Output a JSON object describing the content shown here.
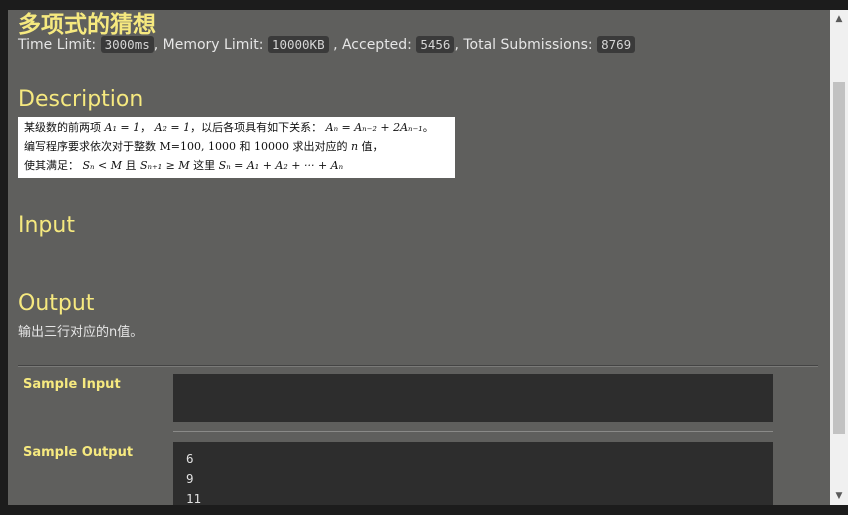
{
  "problem": {
    "title": "多项式的猜想",
    "limits": {
      "time_label": "Time Limit:",
      "time_value": "3000ms",
      "sep1": ",",
      "memory_label": "Memory Limit:",
      "memory_value": "10000KB",
      "sep2": ",",
      "accepted_label": "Accepted:",
      "accepted_value": "5456",
      "sep3": ",",
      "submissions_label": "Total Submissions:",
      "submissions_value": "8769"
    },
    "description_heading": "Description",
    "description_lines": {
      "line1_a": "某级数的前两项",
      "line1_f1": "A₁ = 1",
      "line1_b": "，",
      "line1_f2": "A₂ = 1",
      "line1_c": "，以后各项具有如下关系：",
      "line1_f3": "Aₙ = Aₙ₋₂ + 2Aₙ₋₁",
      "line1_d": "。",
      "line2_a": "编写程序要求依次对于整数 M=100, 1000 和 10000 求出对应的",
      "line2_f": "n",
      "line2_b": "值，",
      "line3_a": "使其满足：",
      "line3_f1": "Sₙ < M",
      "line3_b": "且",
      "line3_f2": "Sₙ₊₁ ≥ M",
      "line3_c": "这里",
      "line3_f3": "Sₙ = A₁ + A₂ + ··· + Aₙ"
    },
    "input_heading": "Input",
    "output_heading": "Output",
    "output_text": "输出三行对应的n值。",
    "sample_input_label": "Sample Input",
    "sample_input": "",
    "sample_output_label": "Sample Output",
    "sample_output_lines": [
      "6",
      "9",
      "11"
    ]
  },
  "colors": {
    "heading": "#f6e97f",
    "background": "#5f5f5d",
    "code_bg": "#2d2d2d"
  },
  "icons": {
    "scroll_up": "scroll-up-arrow-icon",
    "scroll_down": "scroll-down-arrow-icon"
  }
}
